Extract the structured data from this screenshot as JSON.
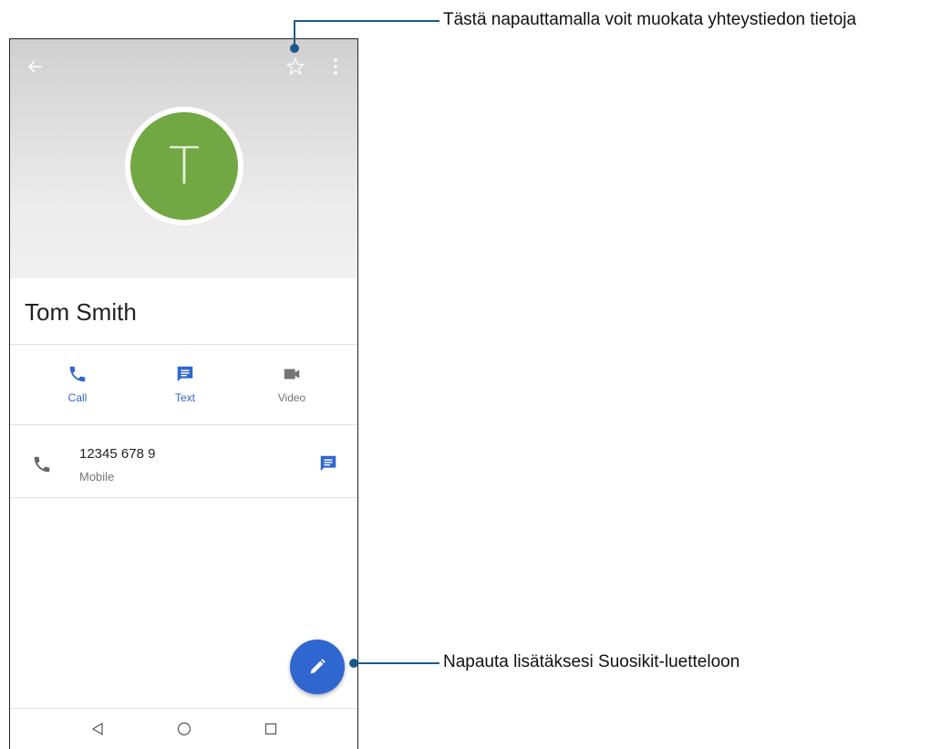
{
  "contact": {
    "initial": "T",
    "name": "Tom Smith",
    "avatar_color": "#72a843"
  },
  "actions": [
    {
      "label": "Call",
      "icon": "phone-icon",
      "color": "#2f66d0"
    },
    {
      "label": "Text",
      "icon": "message-icon",
      "color": "#2f66d0"
    },
    {
      "label": "Video",
      "icon": "videocam-icon",
      "color": "#757575"
    }
  ],
  "phone_entry": {
    "number": "12345 678 9",
    "type": "Mobile"
  },
  "toolbar": {
    "back_icon": "arrow-back-icon",
    "star_icon": "star-outline-icon",
    "more_icon": "more-vert-icon"
  },
  "fab": {
    "icon": "pencil-edit-icon",
    "color": "#2f66d0"
  },
  "navbar": {
    "icons": [
      "back-triangle-icon",
      "home-circle-icon",
      "recents-square-icon"
    ]
  },
  "callouts": {
    "top": "Tästä napauttamalla voit muokata yhteystiedon tietoja",
    "bottom": "Napauta lisätäksesi Suosikit-luetteloon"
  }
}
